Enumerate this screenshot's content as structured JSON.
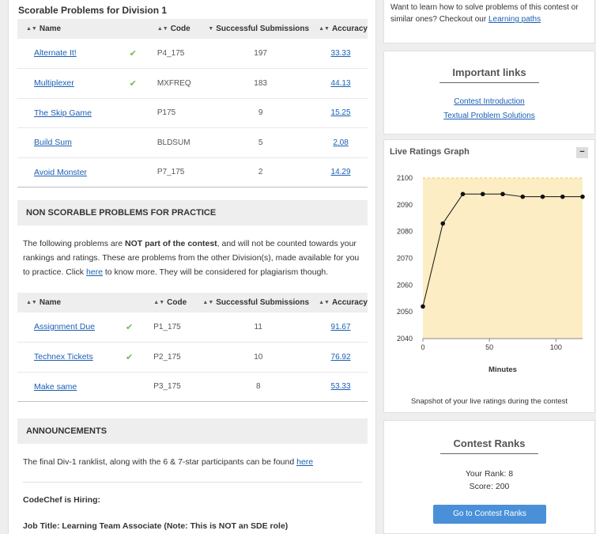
{
  "scorable": {
    "title": "Scorable Problems for Division 1",
    "headers": {
      "name": "Name",
      "code": "Code",
      "subs": "Successful Submissions",
      "accuracy": "Accuracy"
    },
    "rows": [
      {
        "name": "Alternate It!",
        "solved": true,
        "code": "P4_175",
        "subs": "197",
        "accuracy": "33.33"
      },
      {
        "name": "Multiplexer",
        "solved": true,
        "code": "MXFREQ",
        "subs": "183",
        "accuracy": "44.13"
      },
      {
        "name": "The Skip Game",
        "solved": false,
        "code": "P175",
        "subs": "9",
        "accuracy": "15.25"
      },
      {
        "name": "Build Sum",
        "solved": false,
        "code": "BLDSUM",
        "subs": "5",
        "accuracy": "2.08"
      },
      {
        "name": "Avoid Monster",
        "solved": false,
        "code": "P7_175",
        "subs": "2",
        "accuracy": "14.29"
      }
    ]
  },
  "non_scorable": {
    "title": "NON SCORABLE PROBLEMS FOR PRACTICE",
    "desc_1": "The following problems are ",
    "desc_bold": "NOT part of the contest",
    "desc_2": ", and will not be counted towards your rankings and ratings. These are problems from the other Division(s), made available for you to practice. Click ",
    "desc_link": "here",
    "desc_3": " to know more. They will be considered for plagiarism though.",
    "headers": {
      "name": "Name",
      "code": "Code",
      "subs": "Successful Submissions",
      "accuracy": "Accuracy"
    },
    "rows": [
      {
        "name": "Assignment Due",
        "solved": true,
        "code": "P1_175",
        "subs": "11",
        "accuracy": "91.67"
      },
      {
        "name": "Technex Tickets",
        "solved": true,
        "code": "P2_175",
        "subs": "10",
        "accuracy": "76.92"
      },
      {
        "name": "Make same",
        "solved": false,
        "code": "P3_175",
        "subs": "8",
        "accuracy": "53.33"
      }
    ]
  },
  "announcements": {
    "title": "ANNOUNCEMENTS",
    "text": "The final Div-1 ranklist, along with the 6 & 7-star participants can be found ",
    "link": "here",
    "hiring": "CodeChef is Hiring:",
    "job": "Job Title: Learning Team Associate (Note: This is NOT an SDE role)"
  },
  "learn": {
    "text": "Want to learn how to solve problems of this contest or similar ones? Checkout our ",
    "link": "Learning paths"
  },
  "important_links": {
    "title": "Important links",
    "links": [
      "Contest Introduction",
      "Textual Problem Solutions"
    ]
  },
  "ratings_graph": {
    "title": "Live Ratings Graph",
    "collapse_label": "−",
    "snapshot": "Snapshot of your live ratings during the contest"
  },
  "chart_data": {
    "type": "line",
    "title": "",
    "xlabel": "Minutes",
    "ylabel": "",
    "x": [
      0,
      15,
      30,
      45,
      60,
      75,
      90,
      105,
      120
    ],
    "series": [
      {
        "values": [
          2052,
          2083,
          2094,
          2094,
          2094,
          2093,
          2093,
          2093,
          2093
        ]
      }
    ],
    "xlim": [
      0,
      120
    ],
    "ylim": [
      2040,
      2100
    ],
    "xticks": [
      0,
      50,
      100
    ],
    "yticks": [
      2040,
      2050,
      2060,
      2070,
      2080,
      2090,
      2100
    ],
    "grid": false,
    "colors": {
      "plot_bg": "#fdedc4",
      "line": "#111111",
      "top_dash": "#f5c542"
    }
  },
  "contest_ranks": {
    "title": "Contest Ranks",
    "rank_text": "Your Rank: 8",
    "score_text": "Score: 200",
    "button": "Go to Contest Ranks"
  }
}
